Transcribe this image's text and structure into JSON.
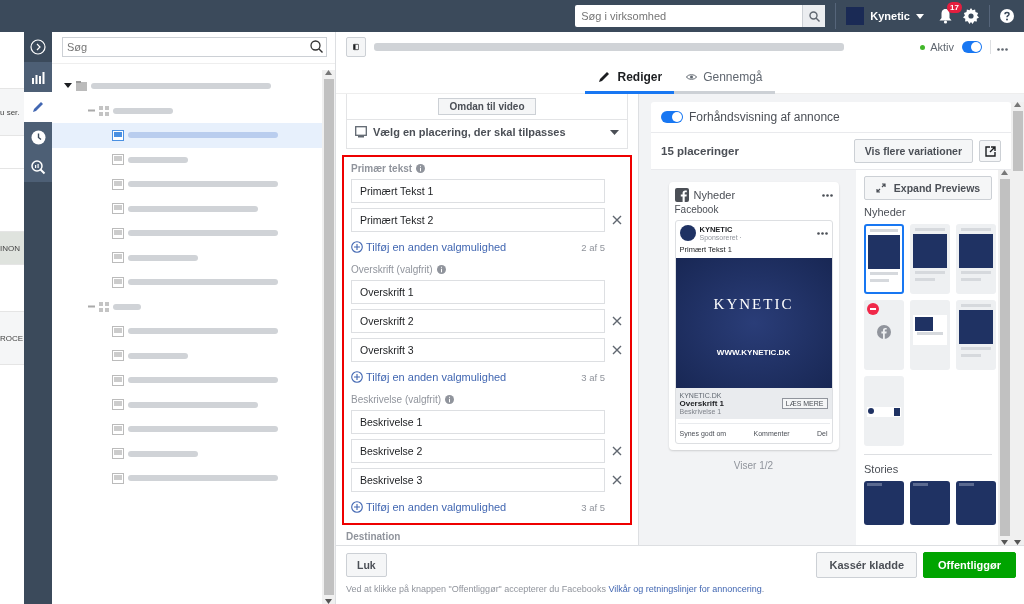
{
  "edge_texts": [
    "u ser.",
    "INON",
    "ROCE"
  ],
  "topbar": {
    "search_placeholder": "Søg i virksomhed",
    "account": "Kynetic",
    "notification_count": "17"
  },
  "rail": [
    {
      "kind": "expand",
      "selected": false
    },
    {
      "kind": "chart",
      "selected": false
    },
    {
      "kind": "pencil",
      "selected": true
    },
    {
      "kind": "clock",
      "selected": false
    },
    {
      "kind": "inspect",
      "selected": false
    }
  ],
  "tree_search": {
    "placeholder": "Søg"
  },
  "tree": [
    {
      "kind": "campaign",
      "expanded": true,
      "selected": false,
      "children": [
        {
          "kind": "adset",
          "expanded": true,
          "selected": false,
          "children": [
            {
              "kind": "ad",
              "selected": true
            },
            {
              "kind": "ad",
              "selected": false
            },
            {
              "kind": "ad",
              "selected": false
            },
            {
              "kind": "ad",
              "selected": false
            },
            {
              "kind": "ad",
              "selected": false
            },
            {
              "kind": "ad",
              "selected": false
            },
            {
              "kind": "ad",
              "selected": false
            }
          ]
        },
        {
          "kind": "adset",
          "expanded": true,
          "selected": false,
          "children": [
            {
              "kind": "ad",
              "selected": false
            },
            {
              "kind": "ad",
              "selected": false
            },
            {
              "kind": "ad",
              "selected": false
            },
            {
              "kind": "ad",
              "selected": false
            },
            {
              "kind": "ad",
              "selected": false
            },
            {
              "kind": "ad",
              "selected": false
            },
            {
              "kind": "ad",
              "selected": false
            }
          ]
        }
      ]
    }
  ],
  "header": {
    "status": "Aktiv",
    "active": true
  },
  "tabs": [
    {
      "label": "Rediger",
      "kind": "pencil",
      "selected": true
    },
    {
      "label": "Gennemgå",
      "kind": "eye",
      "selected": false
    }
  ],
  "form": {
    "video_button": "Omdan til video",
    "placement_select": "Vælg en placering, der skal tilpasses",
    "sections": [
      {
        "label": "Primær tekst",
        "fields": [
          {
            "value": "Primært Tekst 1",
            "removable": false
          },
          {
            "value": "Primært Tekst 2",
            "removable": true
          }
        ],
        "add": "Tilføj en anden valgmulighed",
        "count": "2 af 5"
      },
      {
        "label": "Overskrift (valgfrit)",
        "fields": [
          {
            "value": "Overskrift 1",
            "removable": false
          },
          {
            "value": "Overskrift 2",
            "removable": true
          },
          {
            "value": "Overskrift 3",
            "removable": true
          }
        ],
        "add": "Tilføj en anden valgmulighed",
        "count": "3 af 5"
      },
      {
        "label": "Beskrivelse (valgfrit)",
        "fields": [
          {
            "value": "Beskrivelse 1",
            "removable": false
          },
          {
            "value": "Beskrivelse 2",
            "removable": true
          },
          {
            "value": "Beskrivelse 3",
            "removable": true
          }
        ],
        "add": "Tilføj en anden valgmulighed",
        "count": "3 af 5"
      }
    ],
    "next_section": "Destination"
  },
  "preview": {
    "toggle_label": "Forhåndsvisning af annonce",
    "preview_on": true,
    "placements": "15 placeringer",
    "variations_button": "Vis flere variationer",
    "ad": {
      "placement": "Nyheder",
      "platform": "Facebook",
      "page": "KYNETIC",
      "sponsored": "Sponsoreret · ",
      "primary": "Primært Tekst 1",
      "image_title": "KYNETIC",
      "image_url": "WWW.KYNETIC.DK",
      "domain": "KYNETIC.DK",
      "headline": "Overskrift 1",
      "description": "Beskrivelse 1",
      "cta": "LÆS MERE",
      "actions": [
        "Synes godt om",
        "Kommenter",
        "Del"
      ]
    },
    "pager": "Viser 1/2",
    "expand_button": "Expand Previews",
    "groups": [
      {
        "title": "Nyheder",
        "thumbnails": [
          {
            "kind": "feed",
            "selected": true
          },
          {
            "kind": "feed",
            "selected": false
          },
          {
            "kind": "feed",
            "selected": false
          },
          {
            "kind": "blocked",
            "selected": false
          },
          {
            "kind": "inset",
            "selected": false
          },
          {
            "kind": "feed",
            "selected": false
          },
          {
            "kind": "messenger",
            "selected": false
          }
        ]
      },
      {
        "title": "Stories",
        "thumbnails": [
          {
            "kind": "story",
            "selected": false
          },
          {
            "kind": "story",
            "selected": false
          },
          {
            "kind": "story",
            "selected": false
          }
        ]
      }
    ]
  },
  "footer": {
    "close": "Luk",
    "consent": "Ved at klikke på knappen \"Offentliggør\" accepterer du Facebooks ",
    "consent_link": "Vilkår og retningslinjer for annoncering",
    "consent_end": ".",
    "discard": "Kassér kladde",
    "publish": "Offentliggør"
  }
}
